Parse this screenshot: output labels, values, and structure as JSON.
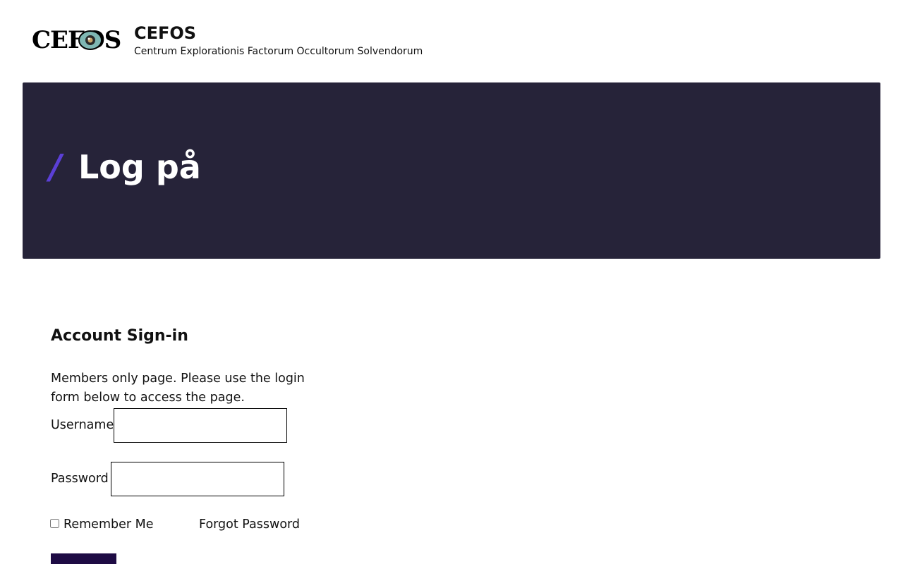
{
  "site": {
    "logo_text": "CEFOS",
    "title": "CEFOS",
    "tagline": "Centrum Explorationis Factorum Occultorum Solvendorum"
  },
  "hero": {
    "slash": "/",
    "title": "Log på"
  },
  "signin": {
    "heading": "Account Sign-in",
    "description": "Members only page. Please use the login form below to access the page.",
    "username_label": "Username",
    "username_value": "",
    "password_label": "Password",
    "password_value": "",
    "remember_label": "Remember Me",
    "remember_checked": false,
    "forgot_label": "Forgot Password"
  },
  "colors": {
    "hero_bg": "#262339",
    "accent": "#5b3fd6",
    "button_bg": "#1e0b44"
  }
}
